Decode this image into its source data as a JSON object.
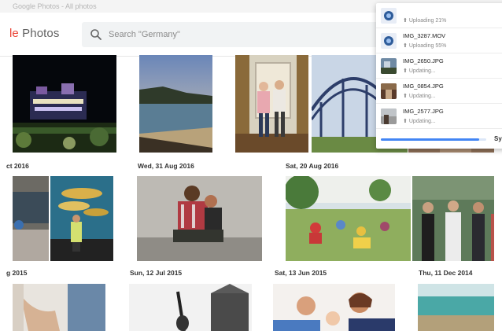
{
  "browser": {
    "tab_fragment": "Google Photos - All photos"
  },
  "header": {
    "logo_prefix": "le",
    "logo_text": " Photos",
    "search_placeholder": "Search \"Germany\""
  },
  "groups": [
    {
      "date": "ct 2016"
    },
    {
      "date": "Wed, 31 Aug 2016"
    },
    {
      "date": "Sat, 20 Aug 2016"
    },
    {
      "date": "g 2015"
    },
    {
      "date": "Sun, 12 Jul 2015"
    },
    {
      "date": "Sat, 13 Jun 2015"
    },
    {
      "date": "Thu, 11 Dec 2014"
    }
  ],
  "uploads": {
    "items": [
      {
        "name": "",
        "status": "Uploading 21%",
        "type": "video"
      },
      {
        "name": "IMG_3287.MOV",
        "status": "Uploading 55%",
        "type": "video"
      },
      {
        "name": "IMG_2650.JPG",
        "status": "Updating...",
        "type": "photo"
      },
      {
        "name": "IMG_0854.JPG",
        "status": "Updating...",
        "type": "photo"
      },
      {
        "name": "IMG_2577.JPG",
        "status": "Updating...",
        "type": "photo"
      }
    ],
    "overall_progress": 0.93,
    "sync_label": "Sy"
  },
  "colors": {
    "accent": "#4285f4",
    "logo_red": "#ea4335"
  }
}
